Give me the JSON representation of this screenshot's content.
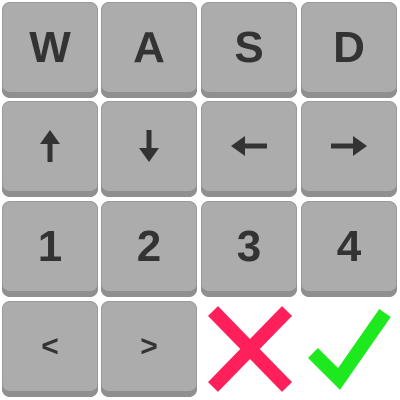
{
  "keys": {
    "row1": [
      "W",
      "A",
      "S",
      "D"
    ],
    "row3": [
      "1",
      "2",
      "3",
      "4"
    ],
    "row4": [
      "<",
      ">"
    ]
  },
  "arrows": [
    "arrow-up",
    "arrow-down",
    "arrow-left",
    "arrow-right"
  ],
  "icons": {
    "cancel": "cross-icon",
    "confirm": "check-icon"
  },
  "colors": {
    "key_face": "#acacac",
    "key_text": "#333333",
    "cancel": "#ff1f5a",
    "confirm": "#1ee81e"
  }
}
